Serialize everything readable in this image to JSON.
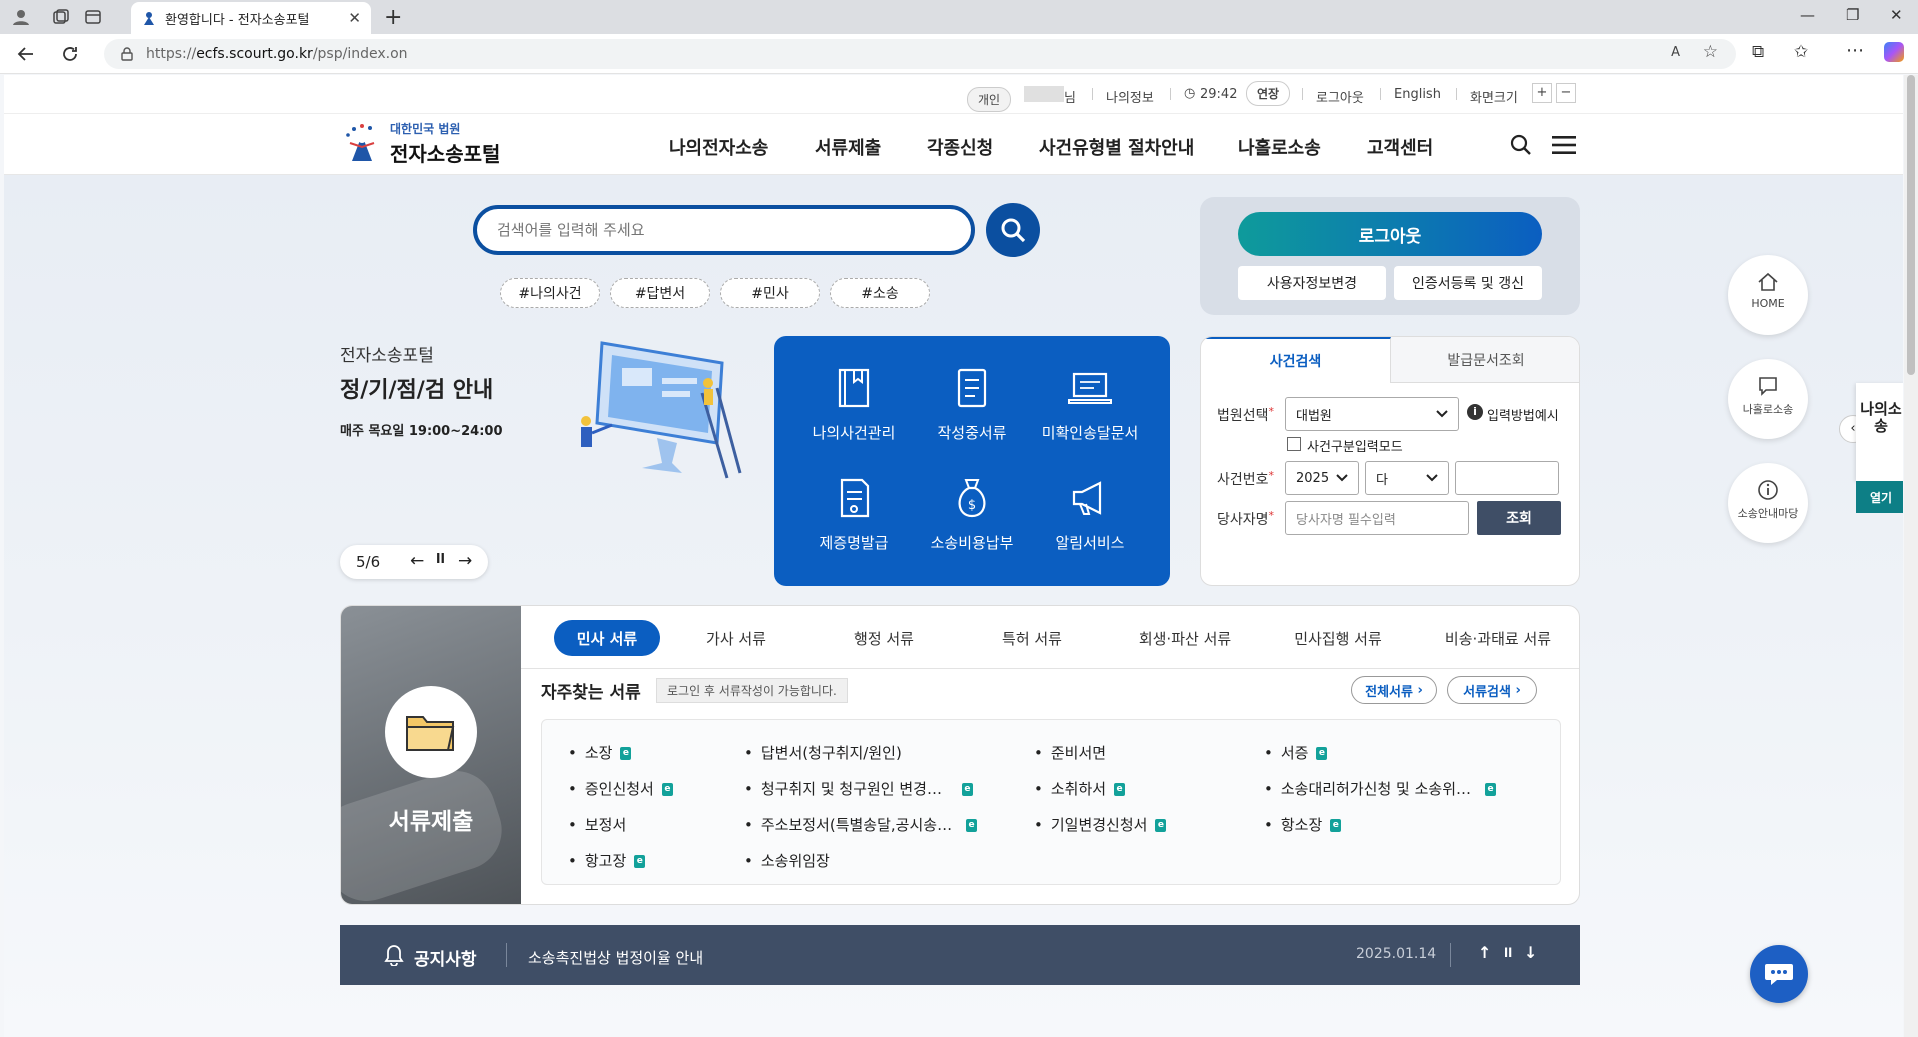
{
  "browser": {
    "tab_title": "환영합니다 - 전자소송포털",
    "url_scheme": "https://",
    "url_host": "ecfs.scourt.go.kr",
    "url_path": "/psp/index.on"
  },
  "util": {
    "badge": "개인",
    "user_suffix": "님",
    "myinfo": "나의정보",
    "timer": "29:42",
    "extend": "연장",
    "logout": "로그아웃",
    "english": "English",
    "zoom": "화면크기",
    "zoom_in": "+",
    "zoom_out": "−"
  },
  "header": {
    "logo_top": "대한민국 법원",
    "logo_main": "전자소송포털",
    "nav": [
      "나의전자소송",
      "서류제출",
      "각종신청",
      "사건유형별 절차안내",
      "나홀로소송",
      "고객센터"
    ]
  },
  "search": {
    "placeholder": "검색어를 입력해 주세요",
    "tags": [
      "#나의사건",
      "#답변서",
      "#민사",
      "#소송"
    ]
  },
  "banner": {
    "sub": "전자소송포털",
    "title": "정/기/점/검 안내",
    "desc": "매주 목요일 19:00~24:00",
    "page": "5/6"
  },
  "quick": [
    "나의사건관리",
    "작성중서류",
    "미확인송달문서",
    "제증명발급",
    "소송비용납부",
    "알림서비스"
  ],
  "login": {
    "logout": "로그아웃",
    "edit": "사용자정보변경",
    "cert": "인증서등록 및 갱신"
  },
  "case_search": {
    "tabs": [
      "사건검색",
      "발급문서조회"
    ],
    "court_label": "법원선택",
    "court_value": "대법원",
    "help": "입력방법예시",
    "checkbox": "사건구분입력모드",
    "number_label": "사건번호",
    "year": "2025",
    "type": "다",
    "party_label": "당사자명",
    "party_placeholder": "당사자명 필수입력",
    "query": "조회"
  },
  "side": {
    "home": "HOME",
    "self": "나홀로소송",
    "guide": "소송안내마당",
    "drawer": "나의소송",
    "open": "열기"
  },
  "docs": {
    "left_title": "서류제출",
    "tabs": [
      "민사 서류",
      "가사 서류",
      "행정 서류",
      "특허 서류",
      "회생·파산 서류",
      "민사집행 서류",
      "비송·과태료 서류"
    ],
    "freq_title": "자주찾는 서류",
    "note": "로그인 후 서류작성이 가능합니다.",
    "all": "전체서류",
    "search": "서류검색",
    "items": [
      {
        "t": "소장",
        "e": true
      },
      {
        "t": "답변서(청구취지/원인)",
        "e": false
      },
      {
        "t": "준비서면",
        "e": false
      },
      {
        "t": "서증",
        "e": true
      },
      {
        "t": "증인신청서",
        "e": true
      },
      {
        "t": "청구취지 및 청구원인 변경…",
        "e": true
      },
      {
        "t": "소취하서",
        "e": true
      },
      {
        "t": "소송대리허가신청 및 소송위…",
        "e": true
      },
      {
        "t": "보정서",
        "e": false
      },
      {
        "t": "주소보정서(특별송달,공시송…",
        "e": true
      },
      {
        "t": "기일변경신청서",
        "e": true
      },
      {
        "t": "항소장",
        "e": true
      },
      {
        "t": "항고장",
        "e": true
      },
      {
        "t": "소송위임장",
        "e": false
      }
    ]
  },
  "notice": {
    "label": "공지사항",
    "text": "소송촉진법상 법정이율 안내",
    "date": "2025.01.14"
  }
}
